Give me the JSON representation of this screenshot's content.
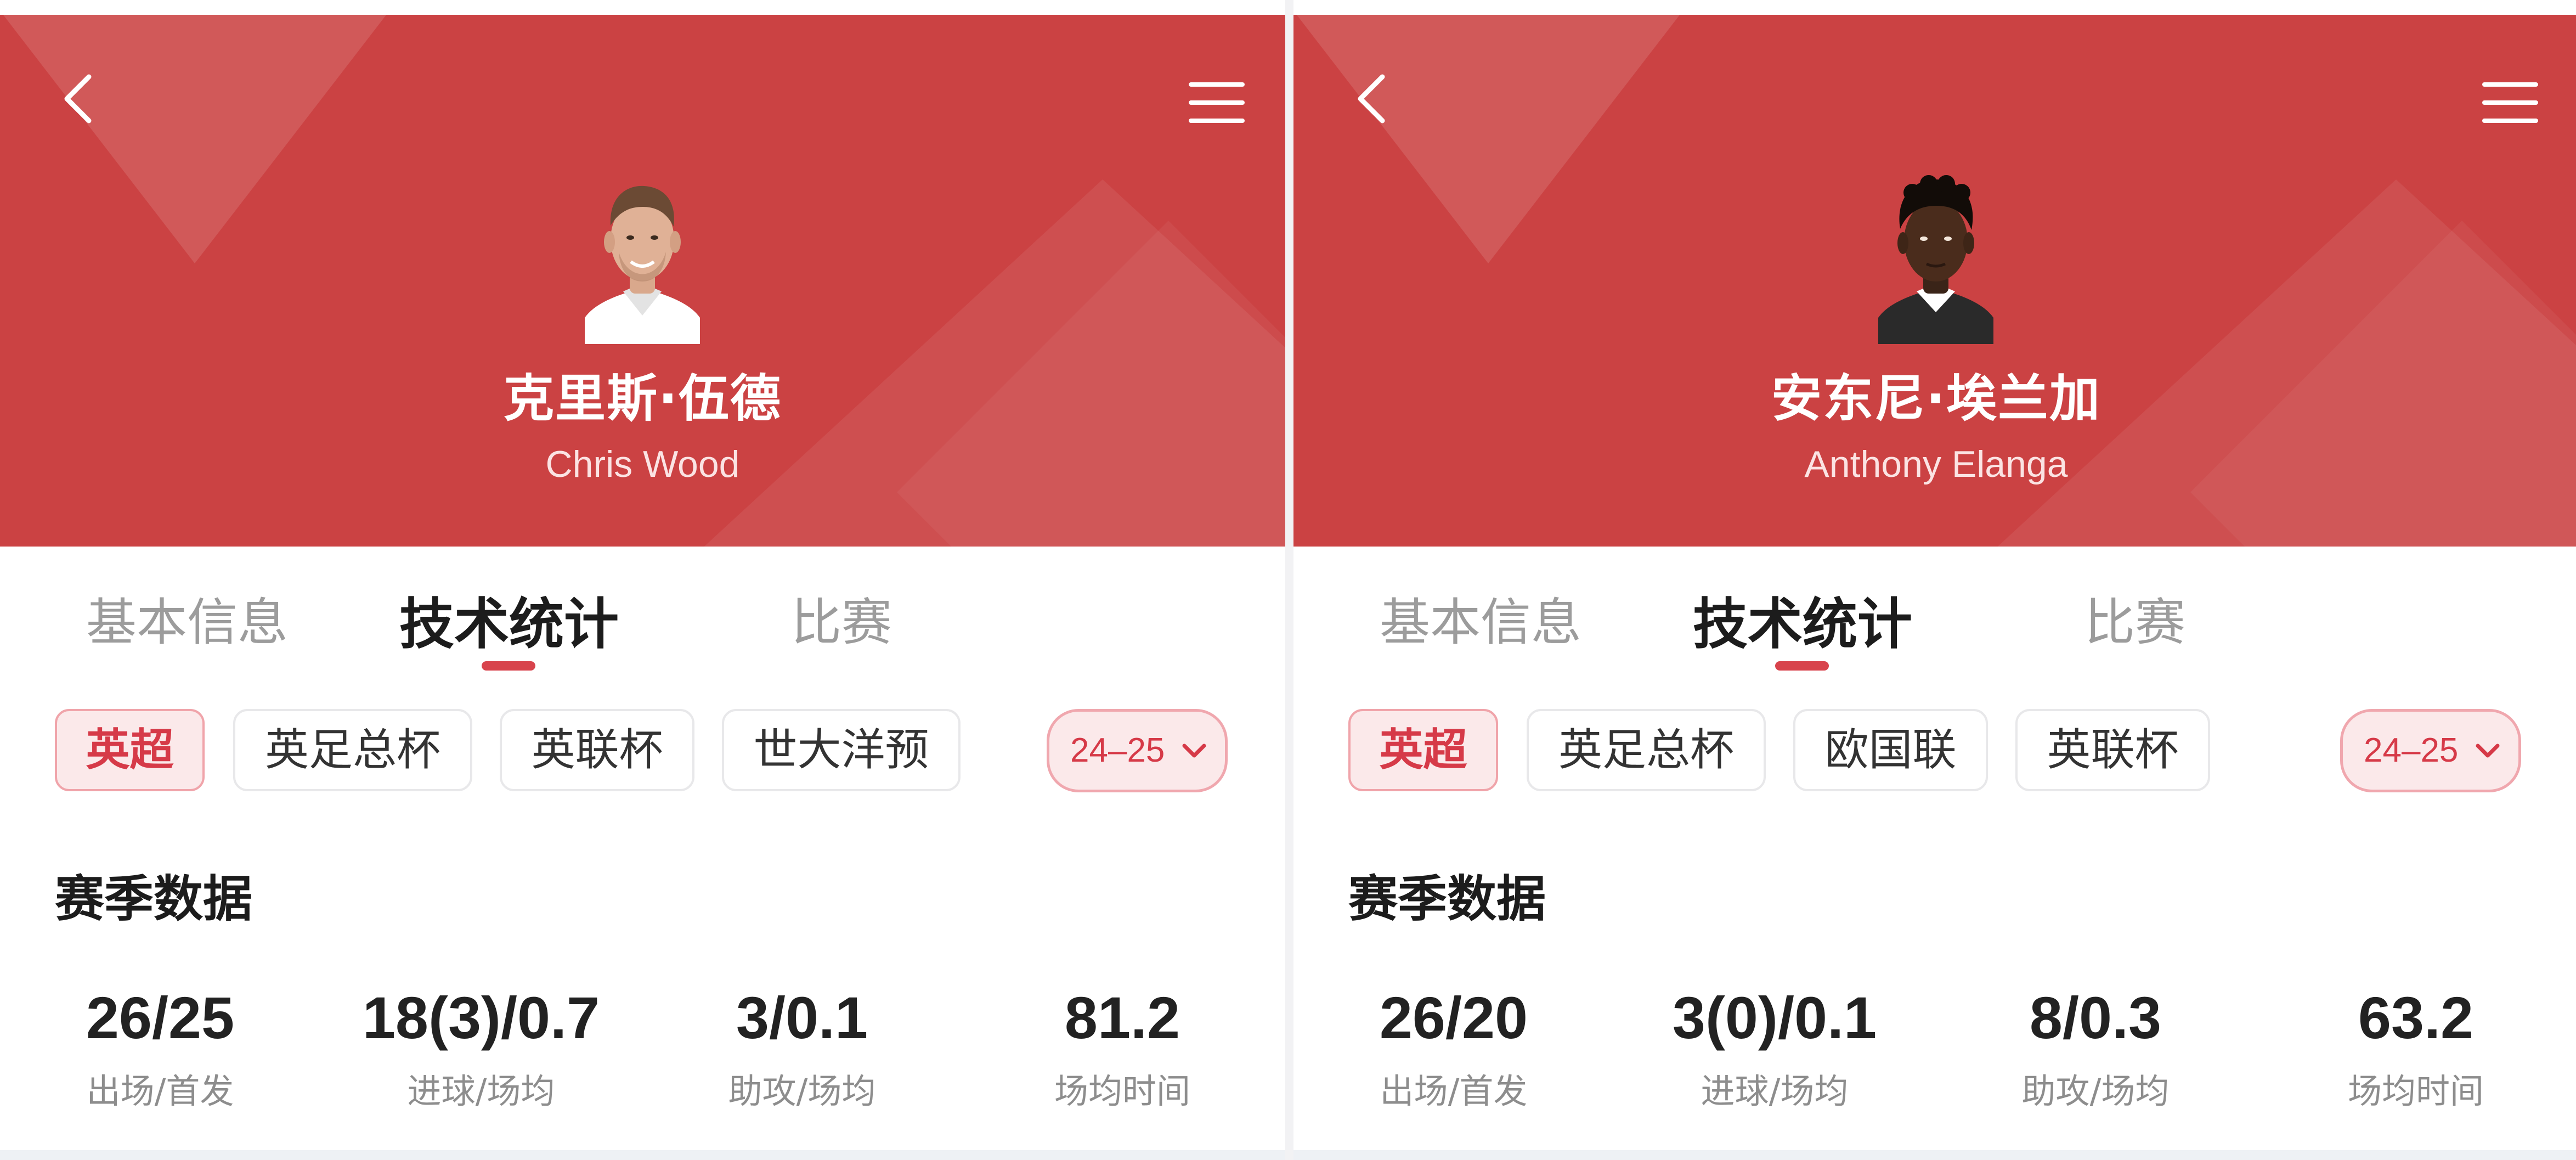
{
  "panels": [
    {
      "player": {
        "name_cn": "克里斯·伍德",
        "name_en": "Chris Wood"
      },
      "tabs": [
        {
          "label": "基本信息",
          "active": false
        },
        {
          "label": "技术统计",
          "active": true
        },
        {
          "label": "比赛",
          "active": false
        }
      ],
      "competitions": [
        {
          "label": "英超",
          "active": true
        },
        {
          "label": "英足总杯",
          "active": false
        },
        {
          "label": "英联杯",
          "active": false
        },
        {
          "label": "世大洋预",
          "active": false
        }
      ],
      "season": "24–25",
      "section_title": "赛季数据",
      "stats": [
        {
          "value": "26/25",
          "label": "出场/首发"
        },
        {
          "value": "18(3)/0.7",
          "label": "进球/场均"
        },
        {
          "value": "3/0.1",
          "label": "助攻/场均"
        },
        {
          "value": "81.2",
          "label": "场均时间"
        }
      ]
    },
    {
      "player": {
        "name_cn": "安东尼·埃兰加",
        "name_en": "Anthony Elanga"
      },
      "tabs": [
        {
          "label": "基本信息",
          "active": false
        },
        {
          "label": "技术统计",
          "active": true
        },
        {
          "label": "比赛",
          "active": false
        }
      ],
      "competitions": [
        {
          "label": "英超",
          "active": true
        },
        {
          "label": "英足总杯",
          "active": false
        },
        {
          "label": "欧国联",
          "active": false
        },
        {
          "label": "英联杯",
          "active": false
        }
      ],
      "season": "24–25",
      "section_title": "赛季数据",
      "stats": [
        {
          "value": "26/20",
          "label": "出场/首发"
        },
        {
          "value": "3(0)/0.1",
          "label": "进球/场均"
        },
        {
          "value": "8/0.3",
          "label": "助攻/场均"
        },
        {
          "value": "63.2",
          "label": "场均时间"
        }
      ]
    }
  ],
  "colors": {
    "header_red": "#cb4243",
    "accent_red": "#d63a48",
    "chip_active_bg": "#fbe9ea"
  },
  "icons": {
    "back": "chevron-left-icon",
    "menu": "hamburger-menu-icon",
    "season_dropdown": "chevron-down-icon"
  }
}
